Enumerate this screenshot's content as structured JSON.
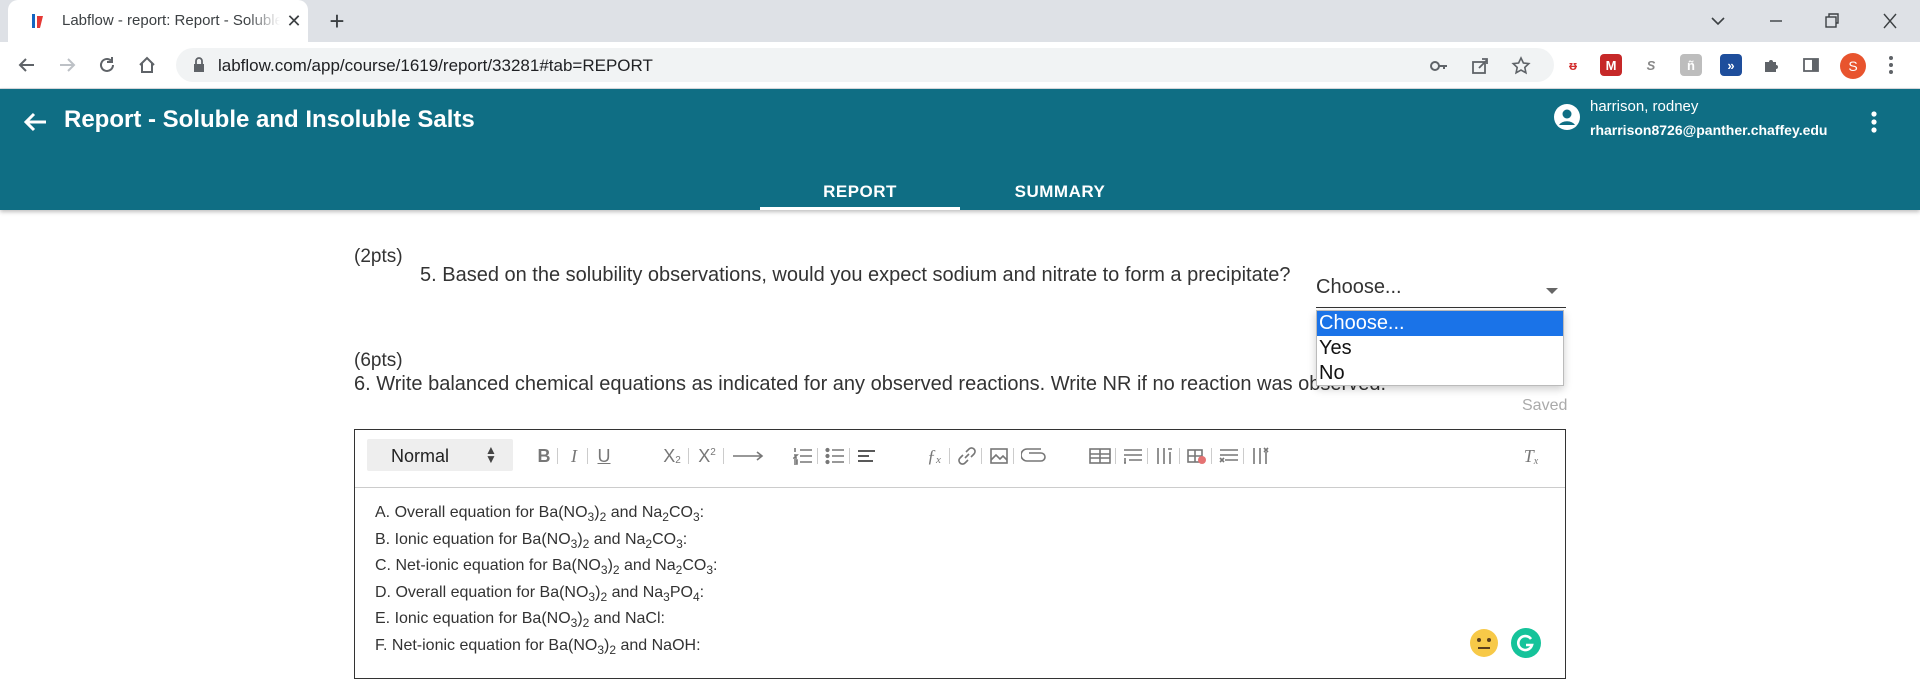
{
  "browser": {
    "tab_title": "Labflow - report: Report - Soluble and Insoluble Salts",
    "url": "labflow.com/app/course/1619/report/33281#tab=REPORT",
    "profile_initial": "S"
  },
  "app": {
    "title": "Report - Soluble and Insoluble Salts",
    "user_name": "harrison, rodney",
    "user_email": "rharrison8726@panther.chaffey.edu",
    "tabs": [
      {
        "label": "REPORT",
        "active": true
      },
      {
        "label": "SUMMARY",
        "active": false
      }
    ],
    "accent": "#0f6e84"
  },
  "question5": {
    "points": "(2pts)",
    "text": "5. Based on the solubility observations, would you expect sodium and nitrate to form a precipitate?",
    "select_value": "Choose...",
    "options": [
      "Choose...",
      "Yes",
      "No"
    ]
  },
  "question6": {
    "points": "(6pts)",
    "text": "6. Write balanced chemical equations as indicated for any observed reactions. Write NR if no reaction was observed.",
    "status": "Saved"
  },
  "editor": {
    "format": "Normal",
    "lines": [
      {
        "pre": "A. Overall equation for Ba(NO",
        "s1": "3",
        "m1": ")",
        "s2": "2",
        "m2": " and Na",
        "s3": "2",
        "m3": "CO",
        "s4": "3",
        "post": ":"
      },
      {
        "pre": "B. Ionic equation for Ba(NO",
        "s1": "3",
        "m1": ")",
        "s2": "2",
        "m2": " and Na",
        "s3": "2",
        "m3": "CO",
        "s4": "3",
        "post": ":"
      },
      {
        "pre": "C. Net-ionic equation for Ba(NO",
        "s1": "3",
        "m1": ")",
        "s2": "2",
        "m2": " and Na",
        "s3": "2",
        "m3": "CO",
        "s4": "3",
        "post": ":"
      },
      {
        "pre": "D. Overall equation for Ba(NO",
        "s1": "3",
        "m1": ")",
        "s2": "2",
        "m2": " and Na",
        "s3": "3",
        "m3": "PO",
        "s4": "4",
        "post": ":"
      },
      {
        "pre": "E. Ionic equation for Ba(NO",
        "s1": "3",
        "m1": ")",
        "s2": "2",
        "m2": " and NaCl:",
        "s3": "",
        "m3": "",
        "s4": "",
        "post": ""
      },
      {
        "pre": "F. Net-ionic equation for Ba(NO",
        "s1": "3",
        "m1": ")",
        "s2": "2",
        "m2": " and NaOH:",
        "s3": "",
        "m3": "",
        "s4": "",
        "post": ""
      }
    ]
  }
}
